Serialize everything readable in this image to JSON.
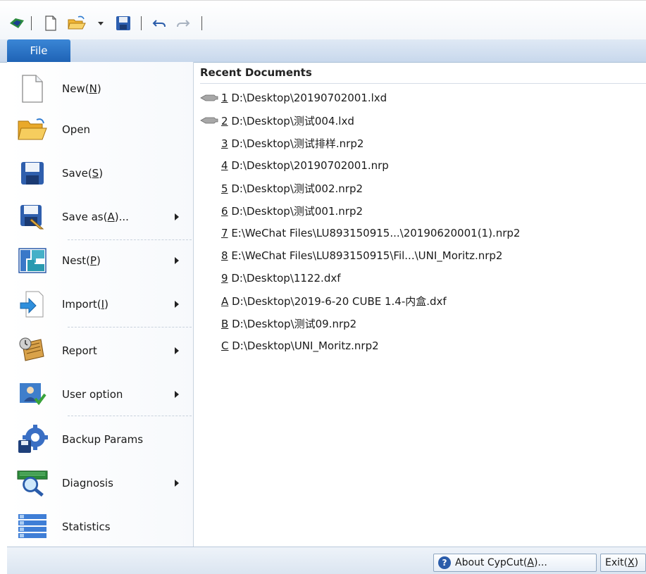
{
  "toolbar": {
    "icons": [
      "app-logo-icon",
      "new-document-icon",
      "open-folder-icon",
      "dropdown-arrow-icon",
      "save-disk-icon",
      "undo-icon",
      "redo-icon"
    ]
  },
  "ribbon": {
    "file_tab": "File"
  },
  "menu": {
    "items": [
      {
        "label": "New(",
        "key": "N",
        "after": ")",
        "submenu": false
      },
      {
        "label": "Open",
        "key": "",
        "after": "",
        "submenu": false
      },
      {
        "label": "Save(",
        "key": "S",
        "after": ")",
        "submenu": false
      },
      {
        "label": "Save as(",
        "key": "A",
        "after": ")...",
        "submenu": true
      },
      {
        "label": "Nest(",
        "key": "P",
        "after": ")",
        "submenu": true
      },
      {
        "label": "Import(",
        "key": "I",
        "after": ")",
        "submenu": true
      },
      {
        "label": "Report",
        "key": "",
        "after": "",
        "submenu": true
      },
      {
        "label": "User option",
        "key": "",
        "after": "",
        "submenu": true
      },
      {
        "label": "Backup Params",
        "key": "",
        "after": "",
        "submenu": false
      },
      {
        "label": "Diagnosis",
        "key": "",
        "after": "",
        "submenu": true
      },
      {
        "label": "Statistics",
        "key": "",
        "after": "",
        "submenu": false
      }
    ]
  },
  "recent": {
    "title": "Recent Documents",
    "docs": [
      {
        "key": "1",
        "path": " D:\\Desktop\\20190702001.lxd",
        "pinned": true
      },
      {
        "key": "2",
        "path": " D:\\Desktop\\测试004.lxd",
        "pinned": true
      },
      {
        "key": "3",
        "path": " D:\\Desktop\\测试排样.nrp2",
        "pinned": false
      },
      {
        "key": "4",
        "path": " D:\\Desktop\\20190702001.nrp",
        "pinned": false
      },
      {
        "key": "5",
        "path": " D:\\Desktop\\测试002.nrp2",
        "pinned": false
      },
      {
        "key": "6",
        "path": " D:\\Desktop\\测试001.nrp2",
        "pinned": false
      },
      {
        "key": "7",
        "path": " E:\\WeChat Files\\LU893150915...\\20190620001(1).nrp2",
        "pinned": false
      },
      {
        "key": "8",
        "path": " E:\\WeChat Files\\LU893150915\\Fil...\\UNI_Moritz.nrp2",
        "pinned": false
      },
      {
        "key": "9",
        "path": " D:\\Desktop\\1122.dxf",
        "pinned": false
      },
      {
        "key": "A",
        "path": " D:\\Desktop\\2019-6-20 CUBE 1.4-内盒.dxf",
        "pinned": false
      },
      {
        "key": "B",
        "path": " D:\\Desktop\\测试09.nrp2",
        "pinned": false
      },
      {
        "key": "C",
        "path": " D:\\Desktop\\UNI_Moritz.nrp2",
        "pinned": false
      }
    ]
  },
  "footer": {
    "about_pre": "About CypCut(",
    "about_key": "A",
    "about_post": ")...",
    "exit_pre": "Exit(",
    "exit_key": "X",
    "exit_post": ")"
  }
}
